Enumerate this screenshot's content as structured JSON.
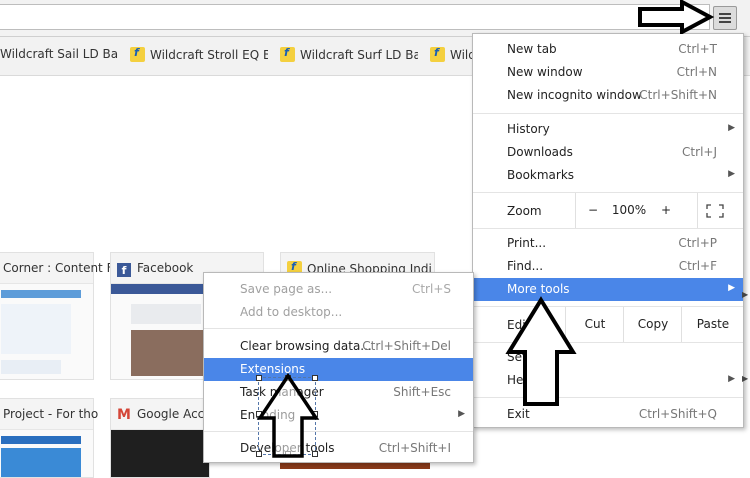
{
  "toolbar": {
    "star_glyph": "☆"
  },
  "bookmarks": [
    {
      "label": "Wildcraft Sail LD Back"
    },
    {
      "label": "Wildcraft Stroll EQ Ba"
    },
    {
      "label": "Wildcraft Surf LD Back"
    },
    {
      "label": "Wild"
    }
  ],
  "tiles": [
    {
      "title": "Corner : Content F"
    },
    {
      "title": "Facebook"
    },
    {
      "title": "Online Shopping Indi"
    },
    {
      "title": "Project - For tho"
    },
    {
      "title": "Google Acco"
    }
  ],
  "main_menu": {
    "new_tab": {
      "label": "New tab",
      "shortcut": "Ctrl+T"
    },
    "new_window": {
      "label": "New window",
      "shortcut": "Ctrl+N"
    },
    "new_incognito": {
      "label": "New incognito window",
      "shortcut": "Ctrl+Shift+N"
    },
    "history": {
      "label": "History"
    },
    "downloads": {
      "label": "Downloads",
      "shortcut": "Ctrl+J"
    },
    "bookmarks": {
      "label": "Bookmarks"
    },
    "zoom": {
      "label": "Zoom",
      "minus": "−",
      "value": "100%",
      "plus": "+"
    },
    "print": {
      "label": "Print...",
      "shortcut": "Ctrl+P"
    },
    "find": {
      "label": "Find...",
      "shortcut": "Ctrl+F"
    },
    "more_tools": {
      "label": "More tools"
    },
    "edit": {
      "label": "Edit",
      "cut": "Cut",
      "copy": "Copy",
      "paste": "Paste"
    },
    "settings": {
      "label": "Settings"
    },
    "help": {
      "label": "Help"
    },
    "exit": {
      "label": "Exit",
      "shortcut": "Ctrl+Shift+Q"
    }
  },
  "sub_menu": {
    "save_page": {
      "label": "Save page as...",
      "shortcut": "Ctrl+S"
    },
    "add_desktop": {
      "label": "Add to desktop..."
    },
    "clear_data": {
      "label": "Clear browsing data...",
      "shortcut": "Ctrl+Shift+Del"
    },
    "extensions": {
      "label": "Extensions"
    },
    "task_manager": {
      "label": "Task manager",
      "shortcut": "Shift+Esc"
    },
    "encoding": {
      "label": "Encoding"
    },
    "dev_tools": {
      "label": "Developer tools",
      "shortcut": "Ctrl+Shift+I"
    }
  },
  "colors": {
    "highlight": "#4a86e8",
    "menu_border": "#b9b9b9"
  }
}
